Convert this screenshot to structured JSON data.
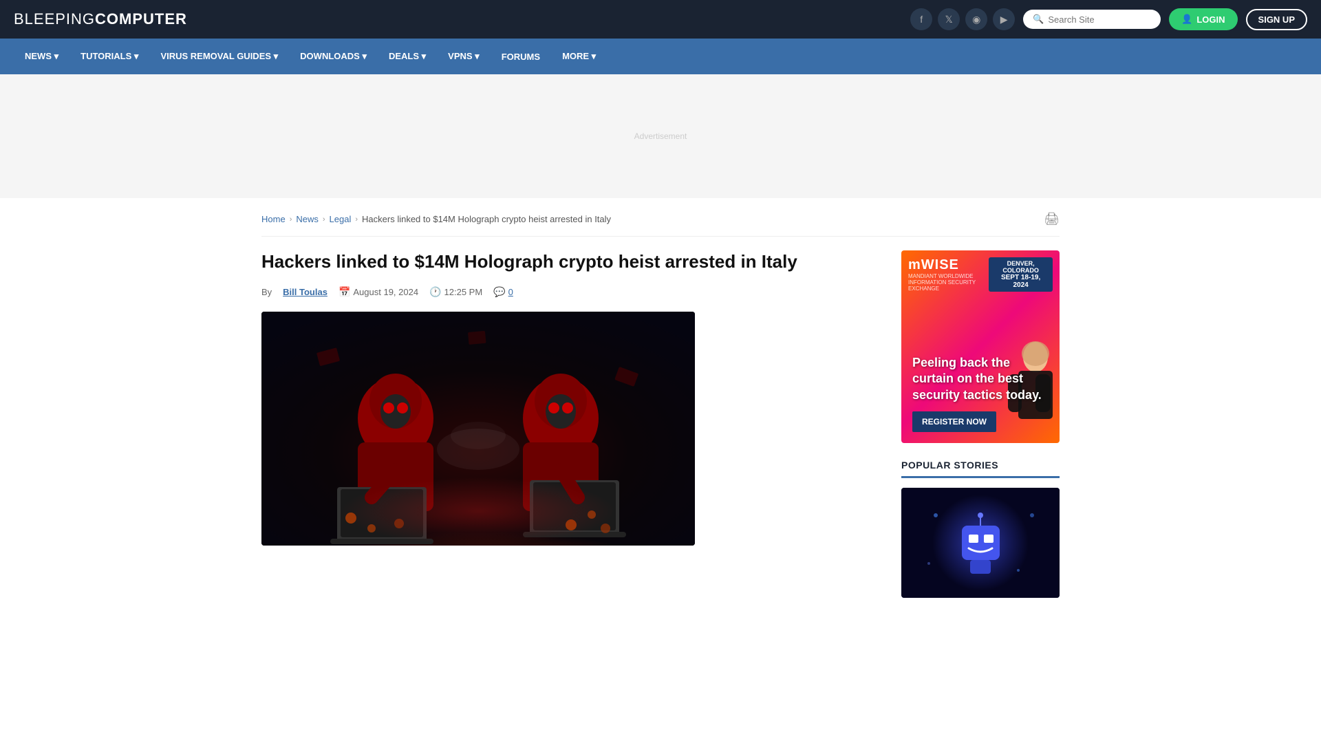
{
  "header": {
    "logo_light": "BLEEPING",
    "logo_bold": "COMPUTER",
    "search_placeholder": "Search Site",
    "login_label": "LOGIN",
    "signup_label": "SIGN UP",
    "social_icons": [
      {
        "name": "facebook-icon",
        "glyph": "f"
      },
      {
        "name": "twitter-icon",
        "glyph": "t"
      },
      {
        "name": "mastodon-icon",
        "glyph": "m"
      },
      {
        "name": "youtube-icon",
        "glyph": "▶"
      }
    ]
  },
  "nav": {
    "items": [
      {
        "label": "NEWS ▾",
        "name": "nav-news"
      },
      {
        "label": "TUTORIALS ▾",
        "name": "nav-tutorials"
      },
      {
        "label": "VIRUS REMOVAL GUIDES ▾",
        "name": "nav-virus"
      },
      {
        "label": "DOWNLOADS ▾",
        "name": "nav-downloads"
      },
      {
        "label": "DEALS ▾",
        "name": "nav-deals"
      },
      {
        "label": "VPNS ▾",
        "name": "nav-vpns"
      },
      {
        "label": "FORUMS",
        "name": "nav-forums"
      },
      {
        "label": "MORE ▾",
        "name": "nav-more"
      }
    ]
  },
  "breadcrumb": {
    "home": "Home",
    "news": "News",
    "legal": "Legal",
    "current": "Hackers linked to $14M Holograph crypto heist arrested in Italy"
  },
  "article": {
    "title": "Hackers linked to $14M Holograph crypto heist arrested in Italy",
    "author": "Bill Toulas",
    "by_label": "By",
    "date": "August 19, 2024",
    "time": "12:25 PM",
    "comments": "0",
    "image_alt": "Two hackers in red hoodies with masks at laptops"
  },
  "sidebar": {
    "ad": {
      "logo": "mWISE",
      "logo_sub": "MANDIANT WORLDWIDE\nINFORMATION SECURITY EXCHANGE",
      "location": "DENVER, COLORADO",
      "dates": "SEPT 18-19, 2024",
      "headline": "Peeling back the curtain on the best security tactics today.",
      "cta": "REGISTER NOW"
    },
    "popular_stories_title": "POPULAR STORIES"
  }
}
